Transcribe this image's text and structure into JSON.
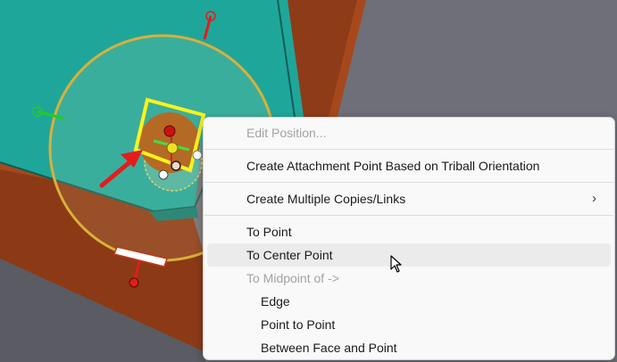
{
  "menu": {
    "items": [
      {
        "label": "Edit Position...",
        "enabled": false
      },
      {
        "label": "Create Attachment Point Based on Triball Orientation",
        "enabled": true
      },
      {
        "label": "Create Multiple Copies/Links",
        "enabled": true,
        "icon": "chevron-right-icon"
      },
      {
        "label": "To Point",
        "enabled": true
      },
      {
        "label": "To Center Point",
        "enabled": true,
        "highlighted": true
      },
      {
        "label": "To Midpoint of ->",
        "enabled": false
      },
      {
        "label": "Edge",
        "enabled": true
      },
      {
        "label": "Point to Point",
        "enabled": true
      },
      {
        "label": "Between Face and Point",
        "enabled": true
      }
    ],
    "submenu_glyph": "›"
  },
  "colors": {
    "teal_face": "#1fa69a",
    "wall_brown": "#8b3a15",
    "triball_ring": "#d8b13a",
    "highlight_yellow": "#fff21a",
    "arrow_red": "#e31c1c",
    "background": "#6e6f78"
  }
}
